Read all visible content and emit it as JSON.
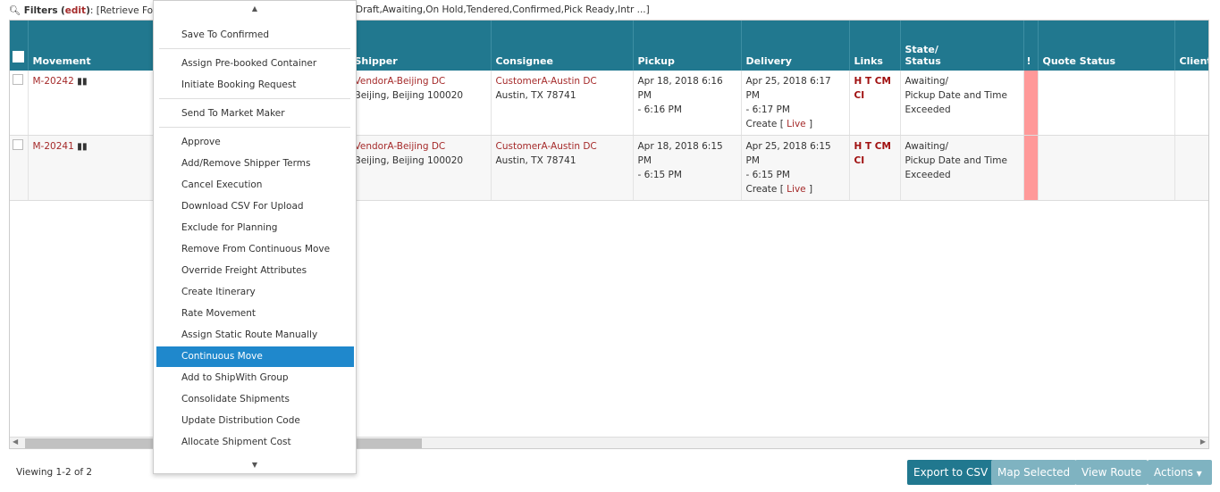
{
  "filters": {
    "label": "Filters",
    "edit": "edit",
    "text_left": "[Retrieve For:",
    "text_right": "Draft,Awaiting,On Hold,Tendered,Confirmed,Pick Ready,Intr ...]"
  },
  "columns": [
    "Movement",
    "",
    "Shipper",
    "Consignee",
    "Pickup",
    "Delivery",
    "Links",
    "State/",
    "Status",
    "!",
    "Quote Status",
    "Client"
  ],
  "rows": [
    {
      "movement": "M-20242",
      "shipper": "VendorA-Beijing DC",
      "shipper_addr": "Beijing, Beijing 100020",
      "consignee": "CustomerA-Austin DC",
      "consignee_addr": "Austin, TX 78741",
      "pickup1": "Apr 18, 2018 6:16 PM",
      "pickup2": "- 6:16 PM",
      "delivery1": "Apr 25, 2018 6:17 PM",
      "delivery2": "- 6:17 PM",
      "create": "Create [",
      "live": "Live",
      "close": "]",
      "links1": "H T CM",
      "links2": "CI",
      "state": "Awaiting/",
      "status1": "Pickup Date and Time",
      "status2": "Exceeded"
    },
    {
      "movement": "M-20241",
      "shipper": "VendorA-Beijing DC",
      "shipper_addr": "Beijing, Beijing 100020",
      "consignee": "CustomerA-Austin DC",
      "consignee_addr": "Austin, TX 78741",
      "pickup1": "Apr 18, 2018 6:15 PM",
      "pickup2": "- 6:15 PM",
      "delivery1": "Apr 25, 2018 6:15 PM",
      "delivery2": "- 6:15 PM",
      "create": "Create [",
      "live": "Live",
      "close": "]",
      "links1": "H T CM",
      "links2": "CI",
      "state": "Awaiting/",
      "status1": "Pickup Date and Time",
      "status2": "Exceeded"
    }
  ],
  "menu": [
    "Save To Confirmed",
    "Assign Pre-booked Container",
    "Initiate Booking Request",
    "Send To Market Maker",
    "Approve",
    "Add/Remove Shipper Terms",
    "Cancel Execution",
    "Download CSV For Upload",
    "Exclude for Planning",
    "Remove From Continuous Move",
    "Override Freight Attributes",
    "Create Itinerary",
    "Rate Movement",
    "Assign Static Route Manually",
    "Continuous Move",
    "Add to ShipWith Group",
    "Consolidate Shipments",
    "Update Distribution Code",
    "Allocate Shipment Cost"
  ],
  "footer": {
    "viewing": "Viewing 1-2 of 2",
    "export": "Export to CSV",
    "map": "Map Selected",
    "route": "View Route",
    "actions": "Actions"
  }
}
